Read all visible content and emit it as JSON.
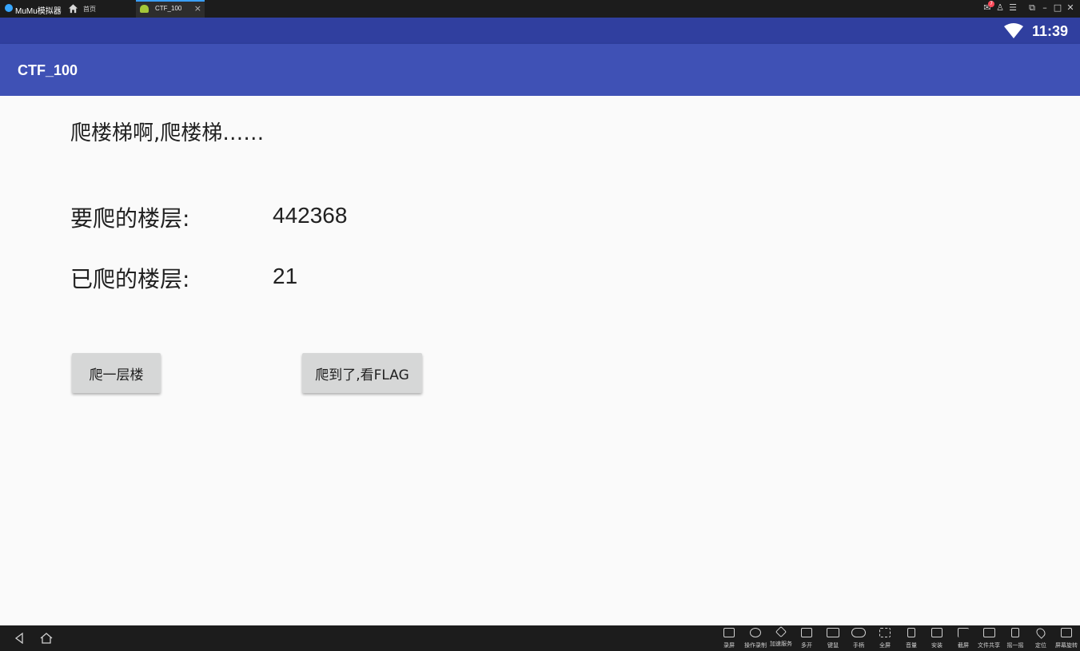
{
  "emulator": {
    "title": "MuMu模拟器",
    "home_tab": "首页",
    "app_tab": "CTF_100",
    "tab_close": "×",
    "message_count": "7"
  },
  "status": {
    "time": "11:39"
  },
  "action_bar": {
    "title": "CTF_100"
  },
  "main": {
    "headline": "爬楼梯啊,爬楼梯……",
    "target_label": "要爬的楼层:",
    "target_value": "442368",
    "climbed_label": "已爬的楼层:",
    "climbed_value": "21",
    "climb_button": "爬一层楼",
    "flag_button": "爬到了,看FLAG"
  },
  "toolbar": {
    "items": [
      {
        "label": "录屏",
        "icon": "record-icon"
      },
      {
        "label": "操作录制",
        "icon": "macro-record-icon"
      },
      {
        "label": "加速服务",
        "icon": "rocket-icon"
      },
      {
        "label": "多开",
        "icon": "multi-instance-icon"
      },
      {
        "label": "键鼠",
        "icon": "keyboard-icon"
      },
      {
        "label": "手柄",
        "icon": "gamepad-icon"
      },
      {
        "label": "全屏",
        "icon": "fullscreen-icon"
      },
      {
        "label": "音量",
        "icon": "volume-icon"
      },
      {
        "label": "安装",
        "icon": "apk-install-icon"
      },
      {
        "label": "截屏",
        "icon": "screenshot-icon"
      },
      {
        "label": "文件共享",
        "icon": "folder-icon"
      },
      {
        "label": "摇一摇",
        "icon": "shake-icon"
      },
      {
        "label": "定位",
        "icon": "location-icon"
      },
      {
        "label": "屏幕旋转",
        "icon": "rotate-icon"
      }
    ]
  },
  "colors": {
    "status_bar": "#303f9f",
    "action_bar": "#3f51b5",
    "background": "#fafafa",
    "button": "#d6d7d7"
  }
}
